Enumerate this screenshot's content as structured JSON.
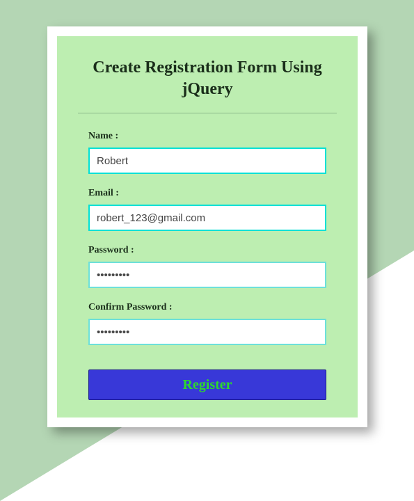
{
  "form": {
    "title": "Create Registration Form Using jQuery",
    "fields": {
      "name": {
        "label": "Name :",
        "value": "Robert"
      },
      "email": {
        "label": "Email :",
        "value": "robert_123@gmail.com"
      },
      "password": {
        "label": "Password :",
        "value": "password1"
      },
      "confirm_password": {
        "label": "Confirm Password :",
        "value": "password1"
      }
    },
    "submit_label": "Register"
  }
}
